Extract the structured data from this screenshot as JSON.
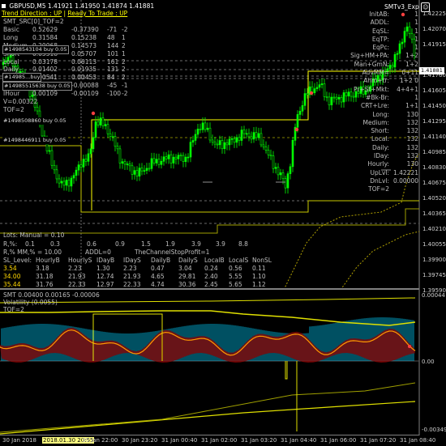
{
  "header": {
    "symbol_line": "GBPUSD,M5  1.41921 1.41950 1.41874 1.41881",
    "ea_name": "SMTv3_Exp",
    "smiley": "☺",
    "trend_direction": "Trend Direction : UP",
    "ready_to_trade": "Ready To Trade : UP",
    "smt_line": "SMT_SRC[0]_TOF=2"
  },
  "left_stats": [
    {
      "label": "Basic",
      "v1": "0.52629",
      "v2": "-0.37390",
      "v3": "-71",
      "v4": "-2"
    },
    {
      "label": "Long",
      "v1": "0.31584",
      "v2": "0.15238",
      "v3": "48",
      "v4": "1"
    },
    {
      "label": "Medium",
      "v1": "0.20068",
      "v2": "0.14573",
      "v3": "144",
      "v4": "2"
    },
    {
      "label": "Short",
      "v1": "0.05518",
      "v2": "0.05707",
      "v3": "101",
      "v4": "1"
    },
    {
      "label": "Local",
      "v1": "0.03178",
      "v2": "0.06113",
      "v3": "161",
      "v4": "2"
    },
    {
      "label": "Daily",
      "v1": "0.01402",
      "v2": "0.01935",
      "v3": "131",
      "v4": "2"
    },
    {
      "label": "IDay",
      "v1": "0.00541",
      "v2": "0.00453",
      "v3": "84",
      "v4": "2"
    },
    {
      "label": "Hourly",
      "v1": "0.00250",
      "v2": "-0.00088",
      "v3": "-45",
      "v4": "-1"
    },
    {
      "label": "IHour",
      "v1": "0.00109",
      "v2": "-0.00109",
      "v3": "-100",
      "v4": "-2"
    }
  ],
  "left_extra": {
    "v_line": "V=0.00322",
    "tof": "TOF=2"
  },
  "orders": [
    {
      "text": "#1498543104 buy 0.05"
    },
    {
      "text": "#14985...buy"
    },
    {
      "text": "#14985515638 buy 0.05"
    },
    {
      "text": "#1498508860 buy 0.05"
    },
    {
      "text": "#1498446911 buy 0.05"
    }
  ],
  "right_panel": {
    "rows": [
      {
        "label": "InitAB:",
        "value": "1"
      },
      {
        "label": "ADDL:",
        "value": "1"
      },
      {
        "label": "EqSL:",
        "value": "1"
      },
      {
        "label": "EqTP:",
        "value": "1"
      },
      {
        "label": "EqPc:",
        "value": "1"
      },
      {
        "label": "Sig+HM+PA:",
        "value": "1+2"
      },
      {
        "label": "Man+GmN:",
        "value": "1+2"
      },
      {
        "label": "AdvMM=",
        "value": "0+11"
      },
      {
        "label": "Ahm+tr:",
        "value": "1+2 0"
      },
      {
        "label": "Pr+St+Mkt:",
        "value": "4+4+1"
      },
      {
        "label": "#Bk-Br:",
        "value": "1"
      },
      {
        "label": "CRT+Lre:",
        "value": "1+1"
      },
      {
        "label": "Long:",
        "value": "130"
      },
      {
        "label": "Medium:",
        "value": "132"
      },
      {
        "label": "Short:",
        "value": "132"
      },
      {
        "label": "Local:",
        "value": "132"
      },
      {
        "label": "Daily:",
        "value": "132"
      },
      {
        "label": "IDay:",
        "value": "132"
      },
      {
        "label": "Hourly:",
        "value": "130"
      },
      {
        "label": "UpLvl:",
        "value": "1.42221"
      },
      {
        "label": "DnLvl:",
        "value": "0.00000"
      },
      {
        "label": "TOF=2",
        "value": ""
      }
    ]
  },
  "bottom_table": {
    "lots_line": "Lots: Manual = 0.10",
    "risk_header": [
      "R,%:",
      "0.1",
      "0.3",
      "0.6",
      "0.9",
      "1.5",
      "1.9",
      "3.9",
      "3.9",
      "8.8"
    ],
    "mm_line": "R,% MM,% = 10.00",
    "addl": "ADDL=0",
    "stop_profit": "TheChannelStopProfit=1",
    "cols": [
      "SL_Level:",
      "HourlyB",
      "HourlyS",
      "IDayB",
      "IDayS",
      "DailyB",
      "DailyS",
      "LocalB",
      "LocalS",
      "NonSL"
    ],
    "rows": [
      [
        "3.54",
        "3.18",
        "2.23",
        "1.30",
        "2.23",
        "0.47",
        "3.04",
        "0.24",
        "0.56",
        "0.11"
      ],
      [
        "34.00",
        "31.18",
        "21.93",
        "12.74",
        "21.93",
        "4.65",
        "29.81",
        "2.40",
        "5.55",
        "1.10"
      ],
      [
        "35.44",
        "31.76",
        "22.33",
        "12.97",
        "22.33",
        "4.74",
        "30.36",
        "2.45",
        "5.65",
        "1.12"
      ]
    ]
  },
  "price_axis": [
    "1.42225",
    "1.42070",
    "1.41915",
    "1.41881",
    "1.41760",
    "1.41605",
    "1.41450",
    "1.41295",
    "1.41140",
    "1.40985",
    "1.40830",
    "1.40675",
    "1.40520",
    "1.40365",
    "1.40210",
    "1.40055",
    "1.39900",
    "1.39745",
    "1.39590"
  ],
  "current_price": "1.41881",
  "indicator": {
    "title_line": "SMT 0.00400 0.00165 -0.00006",
    "sub1": "Volatility (0.0055)",
    "sub2": "TOF=2",
    "axis": [
      "0.00044",
      "0.00",
      "-0.00349"
    ]
  },
  "time_axis": [
    "30 Jan 2018",
    "2018.01.30 20:55",
    "30 Jan 22:00",
    "30 Jan 23:20",
    "31 Jan 00:40",
    "31 Jan 02:00",
    "31 Jan 03:20",
    "31 Jan 04:40",
    "31 Jan 06:00",
    "31 Jan 07:20",
    "31 Jan 08:40"
  ],
  "colors": {
    "bull_candle": "#00ff00",
    "bear_candle": "#00ff00",
    "level_line": "#ffff00",
    "red_dot": "#ff4040",
    "osc_fill": "#00d0ff",
    "osc_fill2": "#8b0000"
  }
}
